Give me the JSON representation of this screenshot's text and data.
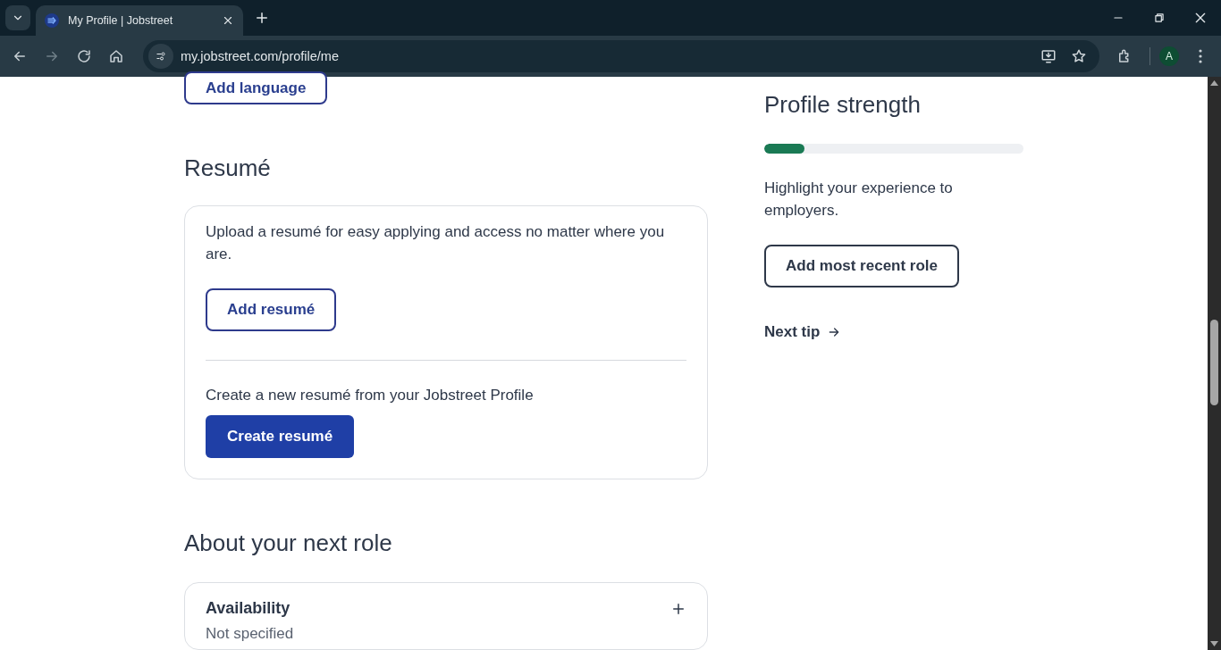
{
  "browser": {
    "tab": {
      "title": "My Profile | Jobstreet",
      "selected": true
    },
    "address": "my.jobstreet.com/profile/me",
    "profile_initial": "A"
  },
  "left": {
    "add_language_button": "Add language",
    "resume": {
      "heading": "Resumé",
      "description": "Upload a resumé for easy applying and access no matter where you are.",
      "add_button": "Add resumé",
      "create_text": "Create a new resumé from your Jobstreet Profile",
      "create_button": "Create resumé"
    },
    "next_role": {
      "heading": "About your next role",
      "items": [
        {
          "title": "Availability",
          "value": "Not specified"
        }
      ]
    }
  },
  "right": {
    "heading": "Profile strength",
    "level": 0.155,
    "tip": "Highlight your experience to employers.",
    "tip_button": "Add most recent role",
    "next_tip": "Next tip"
  }
}
